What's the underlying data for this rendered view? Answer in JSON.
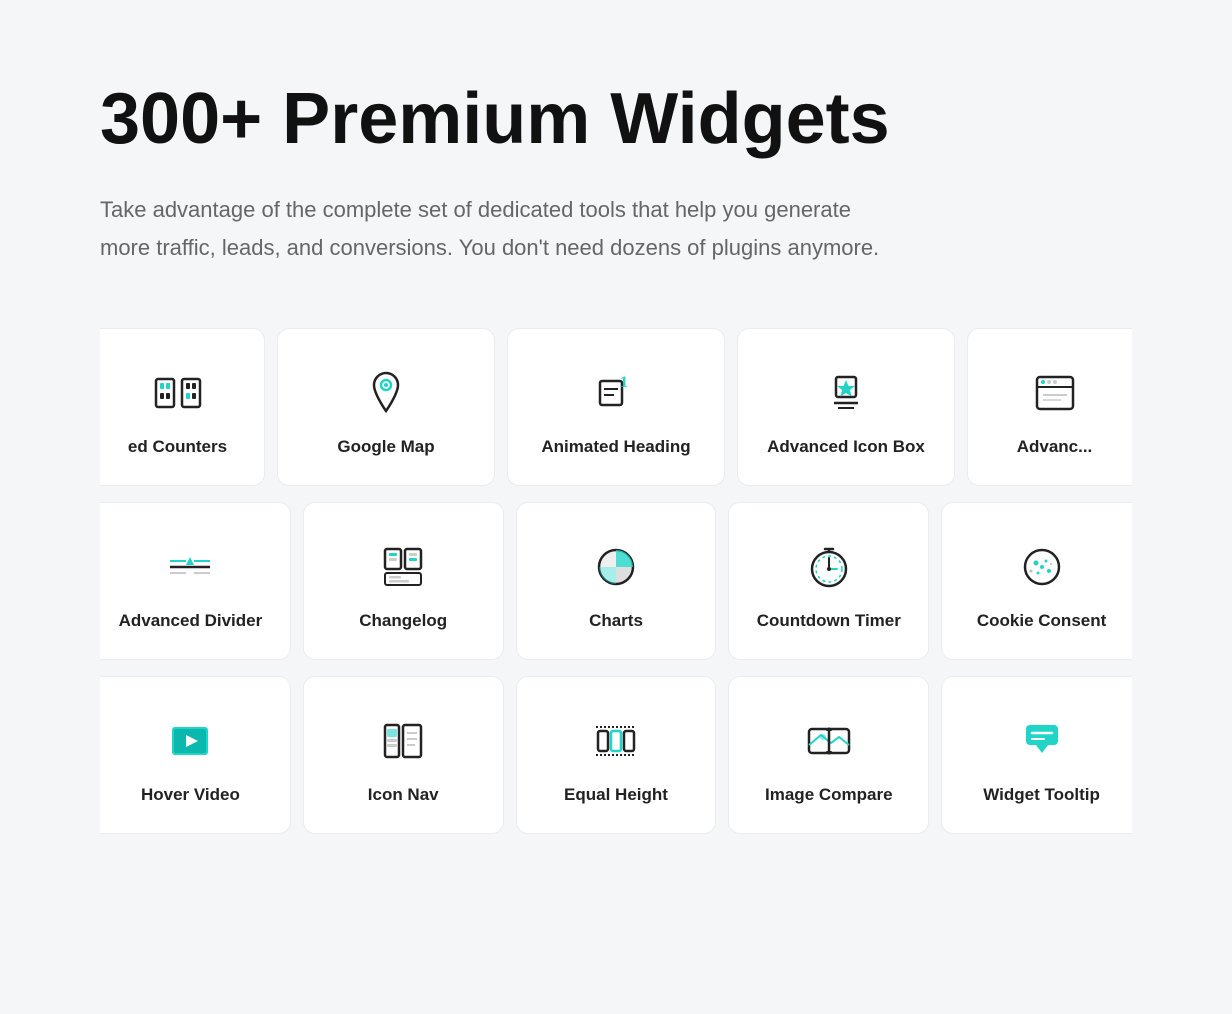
{
  "hero": {
    "title": "300+ Premium Widgets",
    "description": "Take advantage of the complete set of dedicated tools that help you generate more traffic, leads, and conversions. You don't need dozens of plugins anymore."
  },
  "rows": [
    [
      {
        "id": "advanced-counters",
        "label": "ed Counters",
        "icon": "counters",
        "partial": "left"
      },
      {
        "id": "google-map",
        "label": "Google Map",
        "icon": "map"
      },
      {
        "id": "animated-heading",
        "label": "Animated Heading",
        "icon": "animated-heading"
      },
      {
        "id": "advanced-icon-box",
        "label": "Advanced Icon Box",
        "icon": "icon-box"
      },
      {
        "id": "advanced-x",
        "label": "Advanc...",
        "icon": "advanced",
        "partial": "right"
      }
    ],
    [
      {
        "id": "advanced-divider",
        "label": "Advanced Divider",
        "icon": "divider",
        "partial": "left"
      },
      {
        "id": "changelog",
        "label": "Changelog",
        "icon": "changelog"
      },
      {
        "id": "charts",
        "label": "Charts",
        "icon": "charts"
      },
      {
        "id": "countdown-timer",
        "label": "Countdown Timer",
        "icon": "countdown"
      },
      {
        "id": "cookie-consent",
        "label": "Cookie Consent",
        "icon": "cookie",
        "partial": "right"
      }
    ],
    [
      {
        "id": "hover-video",
        "label": "Hover Video",
        "icon": "hover-video",
        "partial": "left"
      },
      {
        "id": "icon-nav",
        "label": "Icon Nav",
        "icon": "icon-nav"
      },
      {
        "id": "equal-height",
        "label": "Equal Height",
        "icon": "equal-height"
      },
      {
        "id": "image-compare",
        "label": "Image Compare",
        "icon": "image-compare"
      },
      {
        "id": "widget-tooltip",
        "label": "Widget Tooltip",
        "icon": "tooltip",
        "partial": "right"
      }
    ]
  ]
}
